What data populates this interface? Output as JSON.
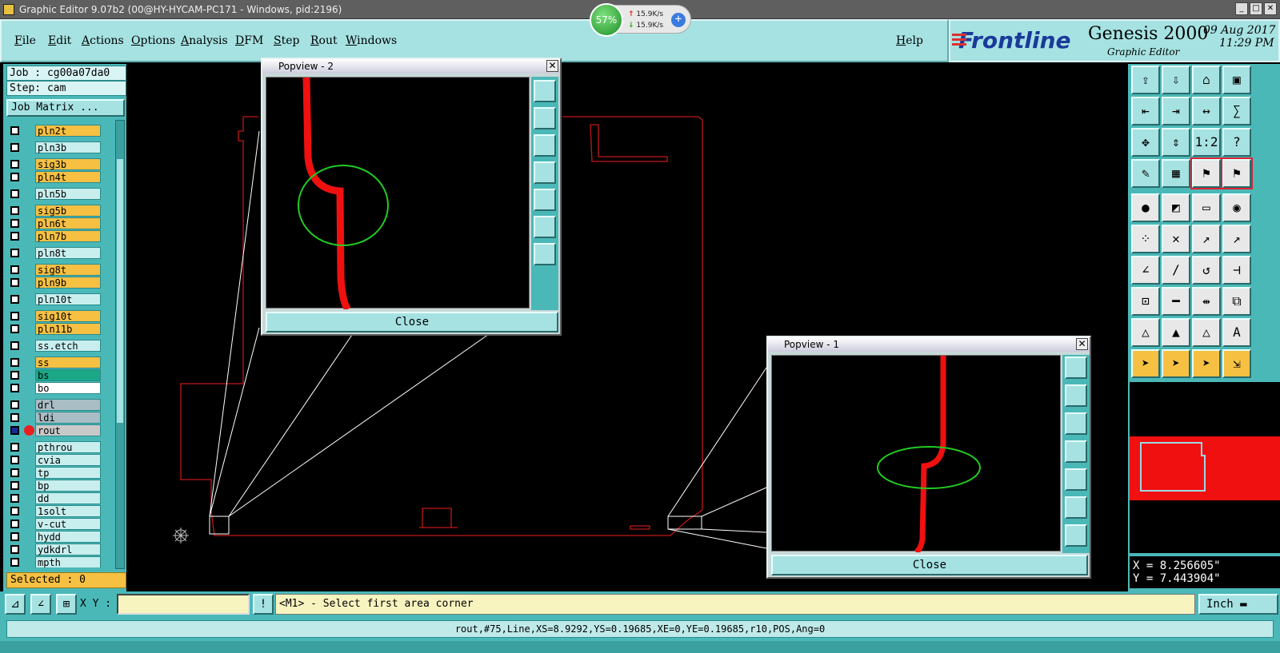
{
  "window": {
    "title": "Graphic Editor 9.07b2 (00@HY-HYCAM-PC171 - Windows, pid:2196)"
  },
  "net_widget": {
    "percent": "57%",
    "upload": "15.9K/s",
    "download": "15.9K/s"
  },
  "menu": [
    "File",
    "Edit",
    "Actions",
    "Options",
    "Analysis",
    "DFM",
    "Step",
    "Rout",
    "Windows"
  ],
  "help": "Help",
  "brand": {
    "logo": "Frontline",
    "product": "Genesis 2000",
    "subtitle": "Graphic Editor",
    "date": "09 Aug 2017",
    "time": "11:29 PM"
  },
  "job": "Job : cg00a07da0",
  "step": "Step: cam",
  "job_matrix": "Job Matrix ...",
  "layers": [
    {
      "name": "pln2t",
      "color": "#f6c043"
    },
    {
      "name": "pln3b",
      "color": "#c8eeee"
    },
    {
      "name": "sig3b",
      "color": "#f6c043"
    },
    {
      "name": "pln4t",
      "color": "#f6c043"
    },
    {
      "name": "pln5b",
      "color": "#c8eeee"
    },
    {
      "name": "sig5b",
      "color": "#f6c043"
    },
    {
      "name": "pln6t",
      "color": "#f6c043"
    },
    {
      "name": "pln7b",
      "color": "#f6c043"
    },
    {
      "name": "pln8t",
      "color": "#c8eeee"
    },
    {
      "name": "sig8t",
      "color": "#f6c043"
    },
    {
      "name": "pln9b",
      "color": "#f6c043"
    },
    {
      "name": "pln10t",
      "color": "#c8eeee"
    },
    {
      "name": "sig10t",
      "color": "#f6c043"
    },
    {
      "name": "pln11b",
      "color": "#f6c043"
    },
    {
      "name": "ss.etch",
      "color": "#c8eeee"
    },
    {
      "name": "ss",
      "color": "#f6c043"
    },
    {
      "name": "bs",
      "color": "#1aa886"
    },
    {
      "name": "bo",
      "color": "#ffffff"
    },
    {
      "name": "drl",
      "color": "#a9bdc4"
    },
    {
      "name": "ldi",
      "color": "#a9bdc4"
    },
    {
      "name": "rout",
      "color": "#c9c9c9"
    },
    {
      "name": "pthrou",
      "color": "#c8eeee"
    },
    {
      "name": "cvia",
      "color": "#c8eeee"
    },
    {
      "name": "tp",
      "color": "#c8eeee"
    },
    {
      "name": "bp",
      "color": "#c8eeee"
    },
    {
      "name": "dd",
      "color": "#c8eeee"
    },
    {
      "name": "1solt",
      "color": "#c8eeee"
    },
    {
      "name": "v-cut",
      "color": "#c8eeee"
    },
    {
      "name": "hydd",
      "color": "#c8eeee"
    },
    {
      "name": "ydkdrl",
      "color": "#c8eeee"
    },
    {
      "name": "mpth",
      "color": "#c8eeee"
    }
  ],
  "selected": "Selected : 0",
  "popview2": {
    "title": "Popview - 2",
    "close": "Close"
  },
  "popview1": {
    "title": "Popview - 1",
    "close": "Close"
  },
  "coords": {
    "x": "X = 8.256605\"",
    "y": "Y = 7.443904\""
  },
  "xy_label": "X Y :",
  "prompt": "<M1> - Select first area corner",
  "units": "Inch",
  "status": "rout,#75,Line,XS=8.9292,YS=0.19685,XE=0,YE=0.19685,r10,POS,Ang=0",
  "colors": {
    "panel": "#4bb8b8",
    "button": "#a6e2e2",
    "rout": "#e02020",
    "highlight": "#22cc22"
  }
}
